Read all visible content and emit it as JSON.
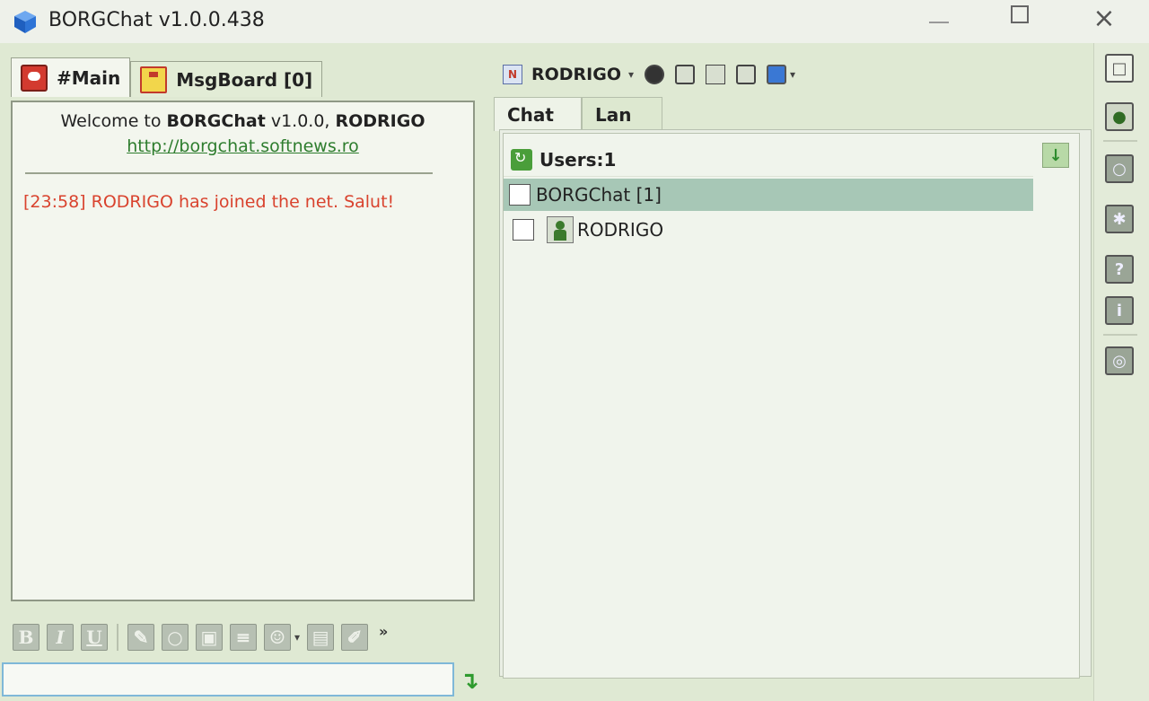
{
  "window": {
    "title": "BORGChat v1.0.0.438",
    "minimize_label": "",
    "maximize_label": "",
    "close_label": "×"
  },
  "left_tabs": [
    {
      "label": "#Main",
      "icon": "chat-bubble-icon"
    },
    {
      "label": "MsgBoard [0]",
      "icon": "message-board-icon"
    }
  ],
  "chat": {
    "welcome_prefix": "Welcome to ",
    "welcome_app": "BORGChat",
    "welcome_version": " v1.0.0, ",
    "welcome_user": "RODRIGO",
    "url": "http://borgchat.softnews.ro",
    "messages": [
      {
        "time": "[23:58]",
        "text": "RODRIGO has joined the net. Salut!",
        "color": "#d9432e"
      }
    ]
  },
  "format_toolbar": {
    "bold": "B",
    "italic": "I",
    "underline": "U",
    "more": "»"
  },
  "input": {
    "value": "",
    "placeholder": ""
  },
  "right_toolbar": {
    "nick_icon_text": "N",
    "nickname": "RODRIGO"
  },
  "right_tabs": [
    {
      "label": "Chat"
    },
    {
      "label": "Lan"
    }
  ],
  "users": {
    "header": "Users:1",
    "group": "BORGChat  [1]",
    "list": [
      {
        "name": "RODRIGO"
      }
    ]
  },
  "sidebar": {
    "help_label": "?",
    "info_label": "i"
  },
  "colors": {
    "accent_green": "#2e7d2e",
    "message_red": "#d9432e",
    "selected_row": "#a7c7b6"
  }
}
